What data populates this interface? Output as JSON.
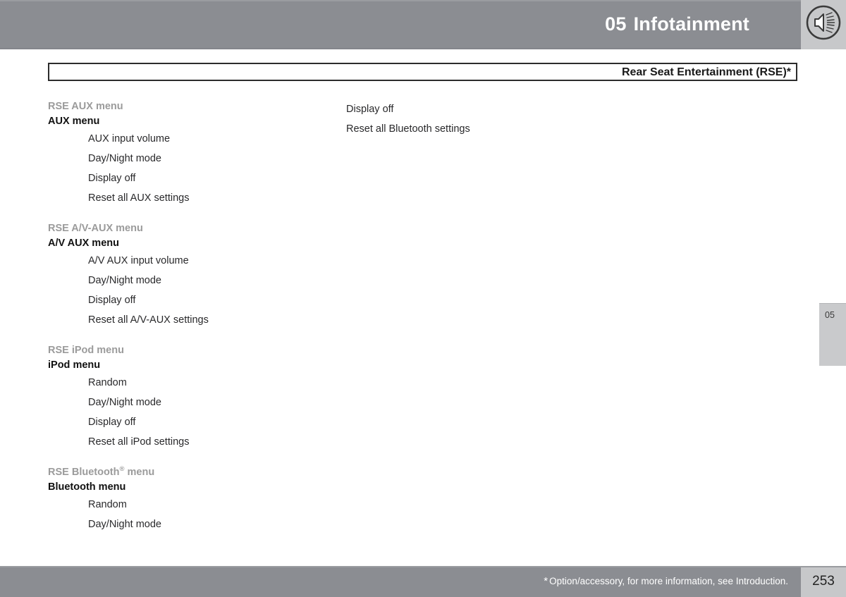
{
  "header": {
    "chapter_number": "05",
    "chapter_title": "Infotainment",
    "icon": "speaker-icon",
    "bar_color": "#8b8d92",
    "icon_box_color": "#c7c8ca"
  },
  "section": {
    "title": "Rear Seat Entertainment (RSE)*"
  },
  "left_column": {
    "groups": [
      {
        "subtitle": "RSE AUX menu",
        "title": "AUX menu",
        "items": [
          "AUX input volume",
          "Day/Night mode",
          "Display off",
          "Reset all AUX settings"
        ]
      },
      {
        "subtitle": "RSE A/V-AUX menu",
        "title": "A/V AUX menu",
        "items": [
          "A/V AUX input volume",
          "Day/Night mode",
          "Display off",
          "Reset all A/V-AUX settings"
        ]
      },
      {
        "subtitle": "RSE iPod menu",
        "title": "iPod menu",
        "items": [
          "Random",
          "Day/Night mode",
          "Display off",
          "Reset all iPod settings"
        ]
      },
      {
        "subtitle": "RSE Bluetooth",
        "subtitle_sup": "®",
        "subtitle_tail": " menu",
        "title": "Bluetooth menu",
        "items": [
          "Random",
          "Day/Night mode"
        ]
      }
    ]
  },
  "right_column": {
    "lines": [
      "Display off",
      "Reset all Bluetooth settings"
    ]
  },
  "side_tab": {
    "label": "05"
  },
  "footer": {
    "asterisk": "*",
    "note": "Option/accessory, for more information, see Introduction.",
    "page_number": "253"
  }
}
